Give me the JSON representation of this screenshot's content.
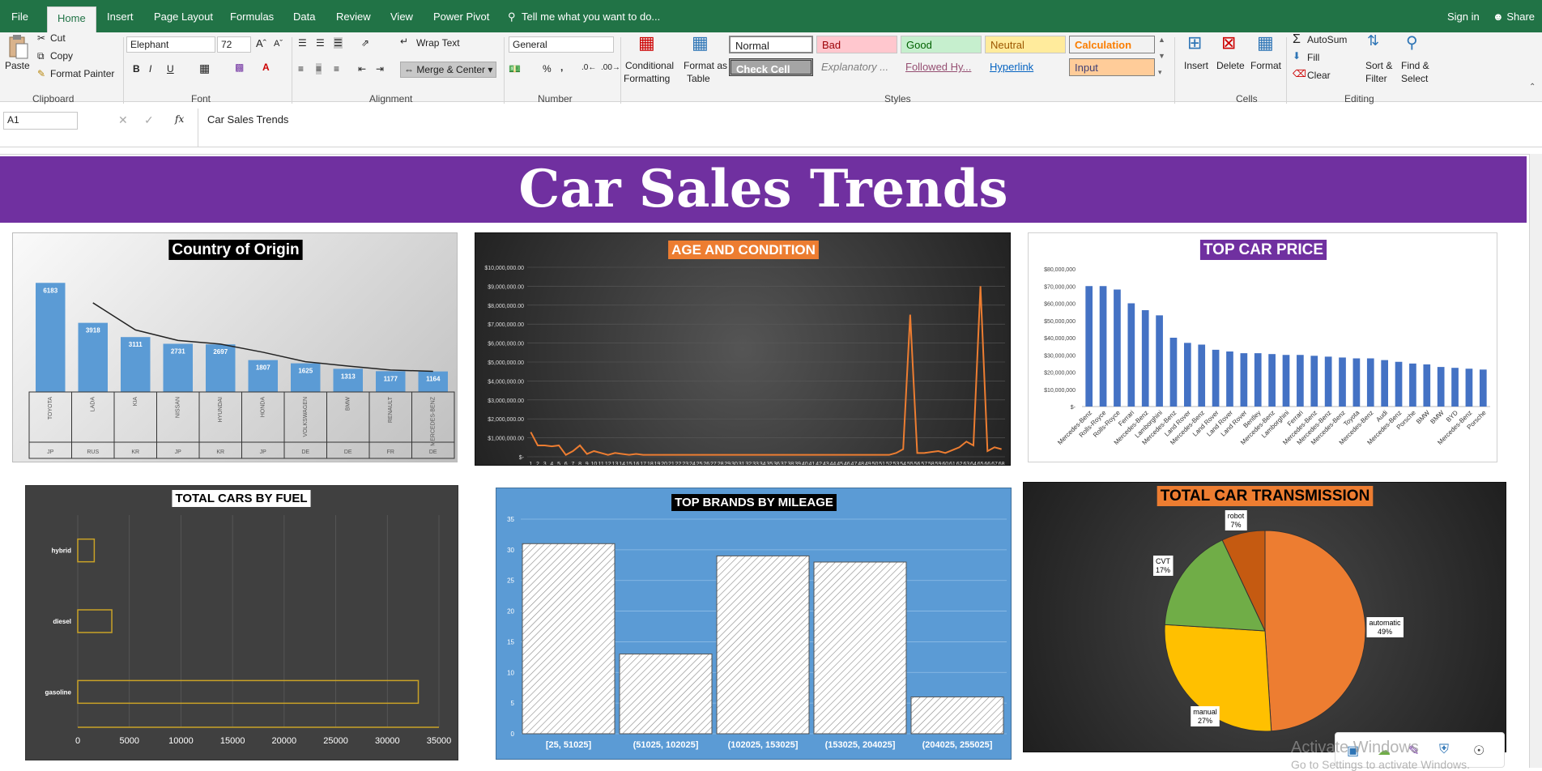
{
  "tabs": [
    "File",
    "Home",
    "Insert",
    "Page Layout",
    "Formulas",
    "Data",
    "Review",
    "View",
    "Power Pivot"
  ],
  "tell_me": "Tell me what you want to do...",
  "sign_in": "Sign in",
  "share": "Share",
  "clipboard": {
    "paste": "Paste",
    "cut": "Cut",
    "copy": "Copy",
    "format_painter": "Format Painter",
    "label": "Clipboard"
  },
  "font": {
    "name": "Elephant",
    "size": "72",
    "label": "Font"
  },
  "alignment": {
    "wrap": "Wrap Text",
    "merge": "Merge & Center",
    "label": "Alignment"
  },
  "number": {
    "format": "General",
    "label": "Number",
    "percent": "%",
    "comma": ","
  },
  "styles": {
    "conditional": "Conditional",
    "formatting": "Formatting",
    "format_as": "Format as",
    "table": "Table",
    "normal": "Normal",
    "bad": "Bad",
    "good": "Good",
    "neutral": "Neutral",
    "calculation": "Calculation",
    "check_cell": "Check Cell",
    "explanatory": "Explanatory ...",
    "followed": "Followed Hy...",
    "hyperlink": "Hyperlink",
    "input": "Input",
    "label": "Styles"
  },
  "cells": {
    "insert": "Insert",
    "delete": "Delete",
    "format": "Format",
    "label": "Cells"
  },
  "editing": {
    "autosum": "AutoSum",
    "fill": "Fill",
    "clear": "Clear",
    "sort": "Sort &",
    "filter": "Filter",
    "find": "Find &",
    "select": "Select",
    "label": "Editing"
  },
  "formula_bar": {
    "name_box": "A1",
    "fx": "fx",
    "content": "Car Sales Trends"
  },
  "banner": "Car Sales Trends",
  "colors": {
    "excel_green": "#217346",
    "banner_purple": "#7030a0",
    "bar_blue": "#5b9bd5",
    "orange": "#ed7d31"
  },
  "watermark": {
    "line1": "Activate Windows",
    "line2": "Go to Settings to activate Windows."
  },
  "chart_data": [
    {
      "id": "origin",
      "type": "bar",
      "title": "Country of Origin",
      "categories": [
        "TOYOTA",
        "LADA",
        "KIA",
        "NISSAN",
        "HYUNDAI",
        "HONDA",
        "VOLKSWAGEN",
        "BMW",
        "RENAULT",
        "MERCEDES-BENZ"
      ],
      "countries": [
        "JP",
        "RUS",
        "KR",
        "JP",
        "KR",
        "JP",
        "DE",
        "DE",
        "FR",
        "DE"
      ],
      "values": [
        6183,
        3918,
        3111,
        2731,
        2697,
        1807,
        1625,
        1313,
        1177,
        1164
      ],
      "ylim": [
        0,
        6700
      ],
      "trendline": true
    },
    {
      "id": "age",
      "type": "line",
      "title": "AGE AND CONDITION",
      "x_count": 68,
      "values": [
        1300000,
        600000,
        600000,
        550000,
        600000,
        100000,
        300000,
        600000,
        150000,
        300000,
        200000,
        100000,
        200000,
        150000,
        100000,
        150000,
        100000,
        100000,
        100000,
        100000,
        100000,
        100000,
        100000,
        100000,
        100000,
        100000,
        100000,
        100000,
        100000,
        100000,
        100000,
        100000,
        100000,
        100000,
        100000,
        100000,
        100000,
        100000,
        100000,
        100000,
        100000,
        100000,
        100000,
        100000,
        100000,
        100000,
        100000,
        100000,
        100000,
        100000,
        100000,
        100000,
        200000,
        400000,
        7500000,
        200000,
        200000,
        250000,
        300000,
        200000,
        350000,
        500000,
        800000,
        600000,
        9000000,
        300000,
        500000,
        400000
      ],
      "yticks": [
        "$-",
        "$1,000,000.00",
        "$2,000,000.00",
        "$3,000,000.00",
        "$4,000,000.00",
        "$5,000,000.00",
        "$6,000,000.00",
        "$7,000,000.00",
        "$8,000,000.00",
        "$9,000,000.00",
        "$10,000,000.00"
      ],
      "ylim": [
        0,
        10000000
      ]
    },
    {
      "id": "price",
      "type": "bar",
      "title": "TOP CAR PRICE",
      "categories": [
        "Mercedes-Benz",
        "Rolls-Royce",
        "Rolls-Royce",
        "Ferrari",
        "Mercedes-Benz",
        "Lamborghini",
        "Mercedes-Benz",
        "Land Rover",
        "Mercedes-Benz",
        "Land Rover",
        "Land Rover",
        "Land Rover",
        "Bentley",
        "Mercedes-Benz",
        "Lamborghini",
        "Ferrari",
        "Mercedes-Benz",
        "Mercedes-Benz",
        "Mercedes-Benz",
        "Toyota",
        "Mercedes-Benz",
        "Audi",
        "Mercedes-Benz",
        "Porsche",
        "BMW",
        "BMW",
        "BYD",
        "Mercedes-Benz",
        "Porsche"
      ],
      "values": [
        70000000,
        70000000,
        68000000,
        60000000,
        56000000,
        53000000,
        40000000,
        37000000,
        36000000,
        33000000,
        32000000,
        31000000,
        31000000,
        30500000,
        30000000,
        30000000,
        29500000,
        29000000,
        28500000,
        28000000,
        28000000,
        27000000,
        26000000,
        25000000,
        24500000,
        23000000,
        22500000,
        22000000,
        21500000
      ],
      "yticks": [
        "$-",
        "$10,000,000",
        "$20,000,000",
        "$30,000,000",
        "$40,000,000",
        "$50,000,000",
        "$60,000,000",
        "$70,000,000",
        "$80,000,000"
      ],
      "ylim": [
        0,
        80000000
      ]
    },
    {
      "id": "fuel",
      "type": "bar",
      "title": "TOTAL CARS BY FUEL",
      "categories": [
        "hybrid",
        "diesel",
        "gasoline"
      ],
      "values": [
        1600,
        3300,
        33000
      ],
      "xticks": [
        "0",
        "5000",
        "10000",
        "15000",
        "20000",
        "25000",
        "30000",
        "35000"
      ],
      "xlim": [
        0,
        35000
      ]
    },
    {
      "id": "mileage",
      "type": "bar",
      "title": "TOP BRANDS BY MILEAGE",
      "categories": [
        "[25, 51025]",
        "(51025, 102025]",
        "(102025, 153025]",
        "(153025, 204025]",
        "(204025, 255025]"
      ],
      "values": [
        31,
        13,
        29,
        28,
        6
      ],
      "yticks": [
        "0",
        "5",
        "10",
        "15",
        "20",
        "25",
        "30",
        "35"
      ],
      "ylim": [
        0,
        35
      ]
    },
    {
      "id": "transmission",
      "type": "pie",
      "title": "TOTAL CAR TRANSMISSION",
      "labels": [
        "automatic",
        "manual",
        "CVT",
        "robot"
      ],
      "pct_labels": [
        "49%",
        "27%",
        "17%",
        "7%"
      ],
      "values": [
        49,
        27,
        17,
        7
      ],
      "colors": [
        "#ed7d31",
        "#ffc000",
        "#70ad47",
        "#c55a11"
      ]
    }
  ]
}
